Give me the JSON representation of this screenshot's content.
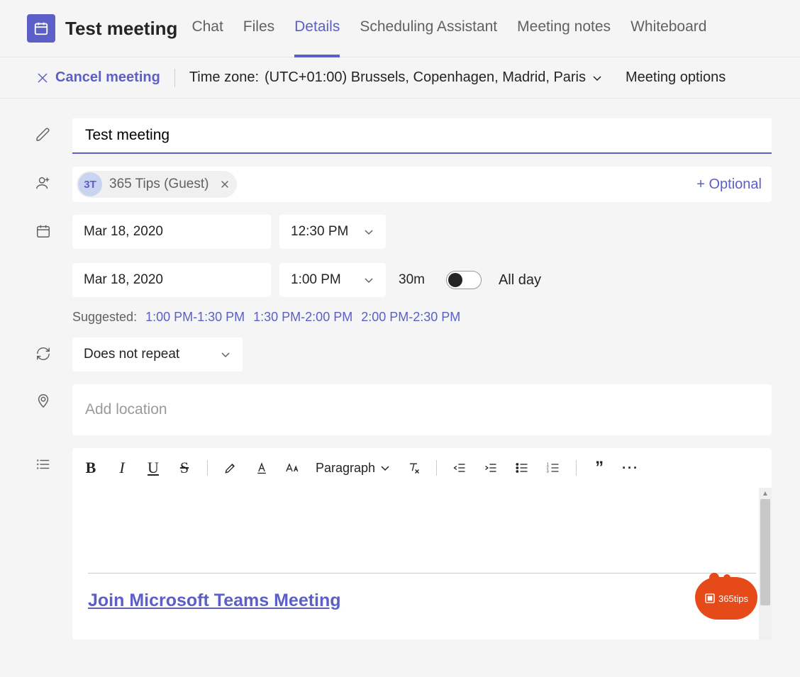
{
  "header": {
    "title": "Test meeting",
    "tabs": [
      {
        "label": "Chat",
        "active": false
      },
      {
        "label": "Files",
        "active": false
      },
      {
        "label": "Details",
        "active": true
      },
      {
        "label": "Scheduling Assistant",
        "active": false
      },
      {
        "label": "Meeting notes",
        "active": false
      },
      {
        "label": "Whiteboard",
        "active": false
      }
    ]
  },
  "actionbar": {
    "cancel_label": "Cancel meeting",
    "timezone_prefix": "Time zone:",
    "timezone_value": "(UTC+01:00) Brussels, Copenhagen, Madrid, Paris",
    "meeting_options_label": "Meeting options"
  },
  "form": {
    "title_value": "Test meeting",
    "attendees": [
      {
        "initials": "3T",
        "name": "365 Tips (Guest)"
      }
    ],
    "add_optional_label": "+ Optional",
    "start_date": "Mar 18, 2020",
    "start_time": "12:30 PM",
    "end_date": "Mar 18, 2020",
    "end_time": "1:00 PM",
    "duration": "30m",
    "all_day_label": "All day",
    "all_day_value": false,
    "suggested_label": "Suggested:",
    "suggested_slots": [
      "1:00 PM-1:30 PM",
      "1:30 PM-2:00 PM",
      "2:00 PM-2:30 PM"
    ],
    "repeat_value": "Does not repeat",
    "location_placeholder": "Add location"
  },
  "editor": {
    "paragraph_label": "Paragraph",
    "join_link_text": "Join Microsoft Teams Meeting"
  },
  "badge": {
    "text": "365tips"
  },
  "icons": {
    "calendar": "calendar-icon",
    "close": "close-icon",
    "pencil": "pencil-icon",
    "person_add": "person-add-icon",
    "clock": "calendar-icon",
    "repeat": "repeat-icon",
    "location": "location-icon",
    "description": "list-icon",
    "chevron_down": "chevron-down-icon"
  }
}
